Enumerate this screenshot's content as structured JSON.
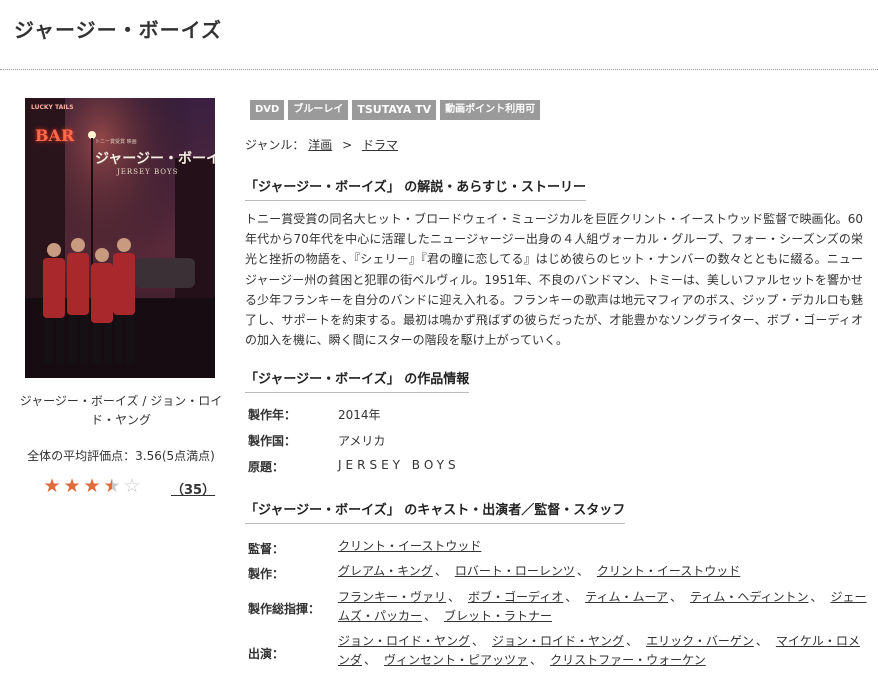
{
  "title": "ジャージー・ボーイズ",
  "poster": {
    "sign_text": "LUCKY TAILS",
    "bar_text": "BAR",
    "top_text": "トニー賞受賞 映画",
    "title_text": "ジャージー・ボーイズ",
    "sub_text": "JERSEY BOYS"
  },
  "sidebar": {
    "caption": "ジャージー・ボーイズ / ジョン・ロイド・ヤング",
    "average_rating_text": "全体の平均評価点：3.56(5点満点)",
    "rating": 3.56,
    "stars": [
      "★",
      "★",
      "★",
      "★",
      "☆"
    ],
    "review_count": "35",
    "paren_open": "（",
    "paren_close": "）"
  },
  "tags": [
    "DVD",
    "ブルーレイ",
    "TSUTAYA TV",
    "動画ポイント利用可"
  ],
  "genre": {
    "label": "ジャンル：",
    "main": "洋画",
    "separator": ">",
    "sub": "ドラマ"
  },
  "sections": {
    "synopsis_heading": "「ジャージー・ボーイズ」 の解説・あらすじ・ストーリー",
    "info_heading": "「ジャージー・ボーイズ」 の作品情報",
    "cast_heading": "「ジャージー・ボーイズ」 のキャスト・出演者／監督・スタッフ"
  },
  "synopsis": "トニー賞受賞の同名大ヒット・ブロードウェイ・ミュージカルを巨匠クリント・イーストウッド監督で映画化。60年代から70年代を中心に活躍したニュージャージー出身の４人組ヴォーカル・グループ、フォー・シーズンズの栄光と挫折の物語を、『シェリー』『君の瞳に恋してる』はじめ彼らのヒット・ナンバーの数々とともに綴る。ニュージャージー州の貧困と犯罪の街ベルヴィル。1951年、不良のバンドマン、トミーは、美しいファルセットを響かせる少年フランキーを自分のバンドに迎え入れる。フランキーの歌声は地元マフィアのボス、ジップ・デカルロも魅了し、サポートを約束する。最初は鳴かず飛ばずの彼らだったが、才能豊かなソングライター、ボブ・ゴーディオの加入を機に、瞬く間にスターの階段を駆け上がっていく。",
  "info": {
    "year_label": "製作年：",
    "year": "2014年",
    "country_label": "製作国：",
    "country": "アメリカ",
    "original_title_label": "原題：",
    "original_title": "JERSEY BOYS"
  },
  "cast": {
    "director_label": "監督：",
    "directors": [
      "クリント・イーストウッド"
    ],
    "producer_label": "製作：",
    "producers": [
      "グレアム・キング",
      "ロバート・ローレンツ",
      "クリント・イーストウッド"
    ],
    "executive_label": "製作総指揮：",
    "executives": [
      "フランキー・ヴァリ",
      "ボブ・ゴーディオ",
      "ティム・ムーア",
      "ティム・ヘディントン",
      "ジェームズ・パッカー",
      "ブレット・ラトナー"
    ],
    "cast_label": "出演：",
    "actors": [
      "ジョン・ロイド・ヤング",
      "ジョン・ロイド・ヤング",
      "エリック・バーゲン",
      "マイケル・ロメンダ",
      "ヴィンセント・ピアッツァ",
      "クリストファー・ウォーケン"
    ],
    "separator": "、"
  }
}
